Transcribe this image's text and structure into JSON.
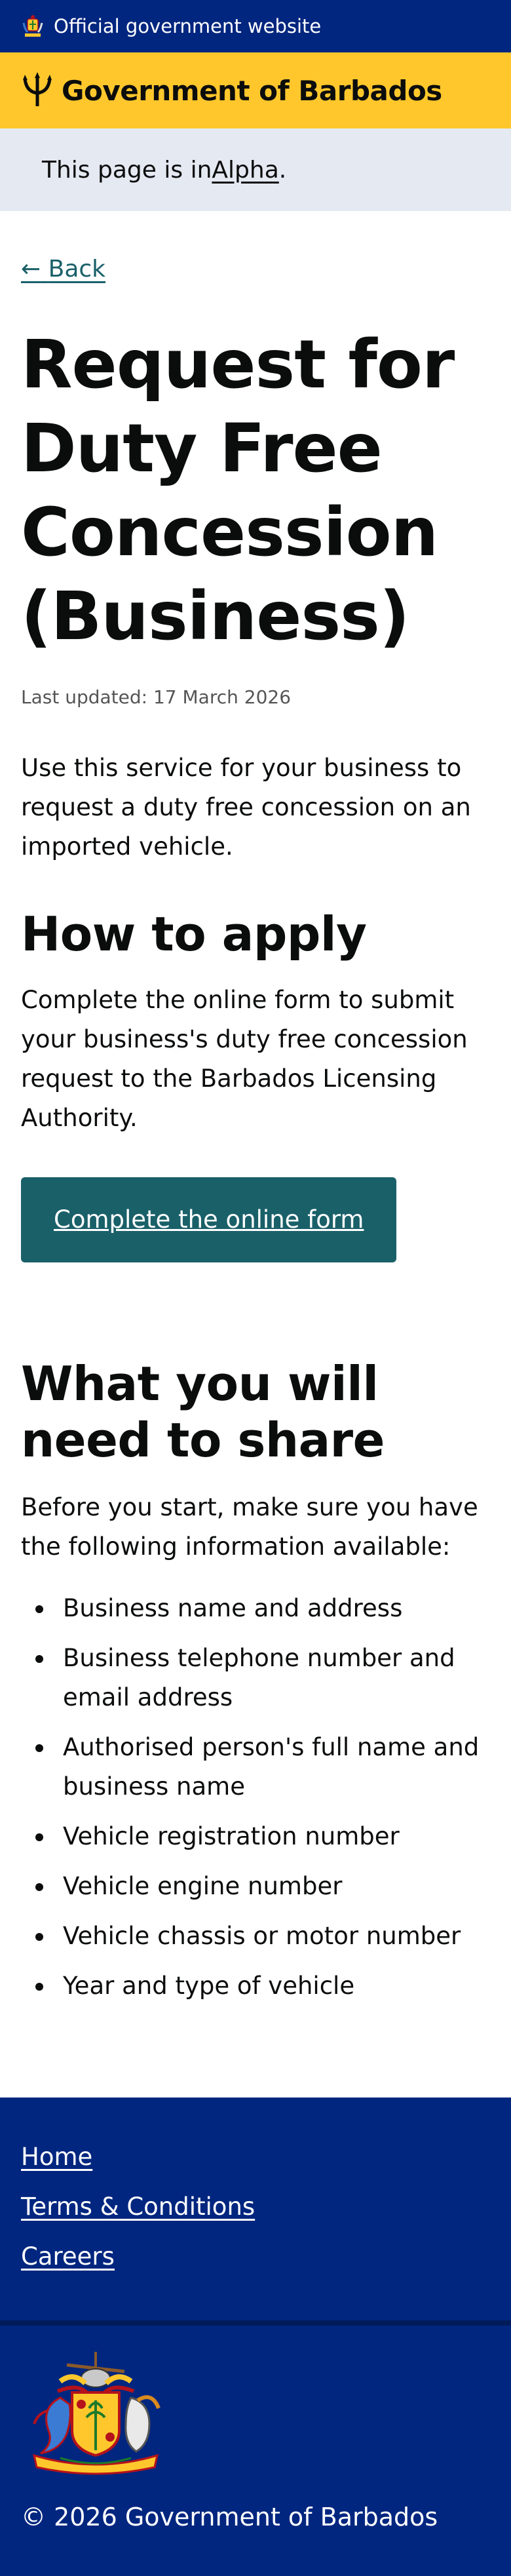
{
  "topbar": {
    "text": "Official government website"
  },
  "brand": {
    "name": "Government of Barbados"
  },
  "phase": {
    "prefix": "This page is in ",
    "link": "Alpha",
    "suffix": "."
  },
  "back": {
    "label": "Back"
  },
  "page": {
    "title": "Request for Duty Free Concession (Business)",
    "updated": "Last updated: 17 March 2026",
    "intro": "Use this service for your business to request a duty free concession on an imported vehicle."
  },
  "apply": {
    "heading": "How to apply",
    "text": "Complete the online form to submit your business's duty free concession request to the Barbados Licensing Authority.",
    "button": "Complete the online form"
  },
  "share": {
    "heading": "What you will need to share",
    "text": "Before you start, make sure you have the following information available:",
    "items": [
      "Business name and address",
      "Business telephone number and email address",
      "Authorised person's full name and business name",
      "Vehicle registration number",
      "Vehicle engine number",
      "Vehicle chassis or motor number",
      "Year and type of vehicle"
    ]
  },
  "footer": {
    "links": [
      "Home",
      "Terms & Conditions",
      "Careers"
    ],
    "copyright": "© 2026 Government of Barbados"
  },
  "icons": {
    "crest_mini": "coat-of-arms-icon",
    "trident": "trident-icon",
    "back_arrow": "arrow-left-icon"
  },
  "colors": {
    "navy": "#00267f",
    "gold": "#ffc72c",
    "teal": "#1a6069",
    "phase_bg": "#e5e9f2"
  }
}
